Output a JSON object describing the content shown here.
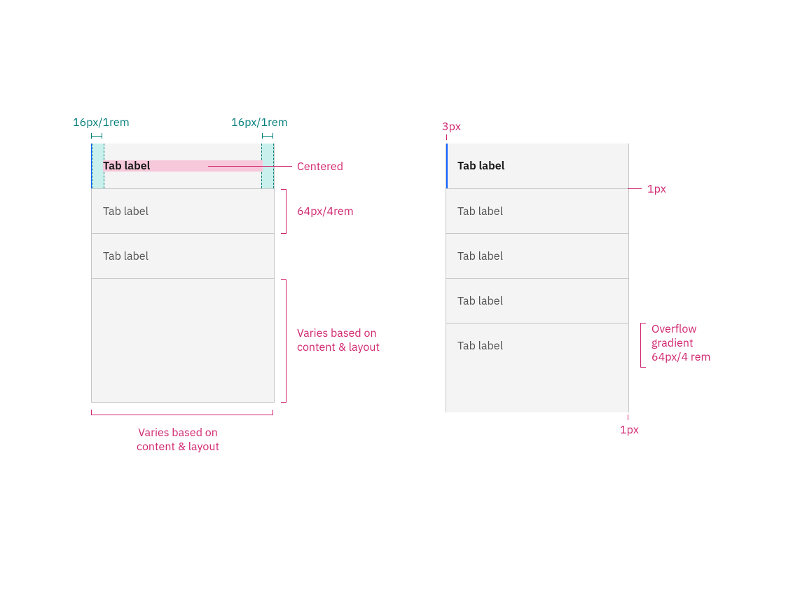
{
  "left": {
    "padding_label_left": "16px/1rem",
    "padding_label_right": "16px/1rem",
    "centered_label": "Centered",
    "tabs": [
      {
        "label": "Tab label",
        "selected": true
      },
      {
        "label": "Tab label",
        "selected": false
      },
      {
        "label": "Tab label",
        "selected": false
      }
    ],
    "row_height_label": "64px/4rem",
    "content_height_label": "Varies based on\ncontent & layout",
    "width_label": "Varies based on\ncontent & layout"
  },
  "right": {
    "indicator_width_label": "3px",
    "divider_label": "1px",
    "bottom_border_label": "1px",
    "overflow_label": "Overflow\ngradient\n64px/4 rem",
    "tabs": [
      {
        "label": "Tab label",
        "selected": true
      },
      {
        "label": "Tab label",
        "selected": false
      },
      {
        "label": "Tab label",
        "selected": false
      },
      {
        "label": "Tab label",
        "selected": false
      },
      {
        "label": "Tab label",
        "selected": false
      }
    ]
  },
  "colors": {
    "teal": "#007d79",
    "magenta": "#d02670",
    "accent": "#0f62fe"
  }
}
